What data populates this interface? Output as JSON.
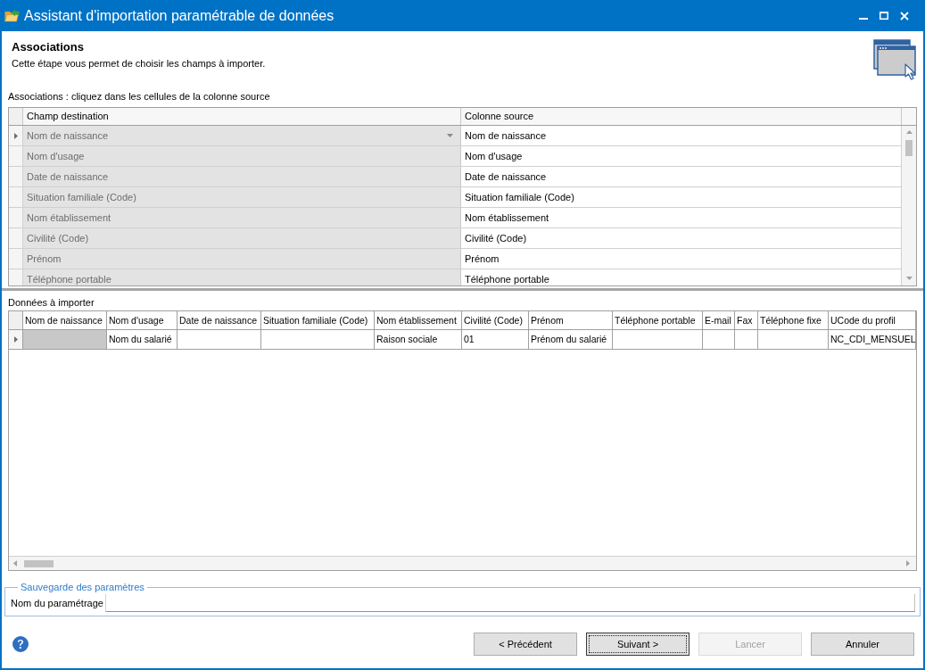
{
  "window": {
    "title": "Assistant d'importation paramétrable de données"
  },
  "header": {
    "title": "Associations",
    "description": "Cette étape vous permet de choisir les champs à importer."
  },
  "associations": {
    "label": "Associations : cliquez dans les cellules de la colonne source",
    "columns": [
      "Champ destination",
      "Colonne source"
    ],
    "rows": [
      {
        "destination": "Nom de naissance",
        "source": "Nom de naissance",
        "selected": true
      },
      {
        "destination": "Nom d'usage",
        "source": "Nom d'usage",
        "selected": false
      },
      {
        "destination": "Date de naissance",
        "source": "Date de naissance",
        "selected": false
      },
      {
        "destination": "Situation familiale (Code)",
        "source": "Situation familiale (Code)",
        "selected": false
      },
      {
        "destination": "Nom établissement",
        "source": "Nom établissement",
        "selected": false
      },
      {
        "destination": "Civilité (Code)",
        "source": "Civilité (Code)",
        "selected": false
      },
      {
        "destination": "Prénom",
        "source": "Prénom",
        "selected": false
      },
      {
        "destination": "Téléphone portable",
        "source": "Téléphone portable",
        "selected": false
      }
    ]
  },
  "import_data": {
    "label": "Données à importer",
    "columns": [
      "Nom de naissance",
      "Nom d'usage",
      "Date de naissance",
      "Situation familiale (Code)",
      "Nom établissement",
      "Civilité (Code)",
      "Prénom",
      "Téléphone portable",
      "E-mail",
      "Fax",
      "Téléphone fixe",
      "UCode du profil"
    ],
    "rows": [
      {
        "selected": true,
        "cells": [
          {
            "focused": true
          },
          {
            "text": "Nom du salarié",
            "focused": false
          },
          {
            "focused": false
          },
          {
            "focused": false
          },
          {
            "text": "Raison sociale",
            "focused": false
          },
          {
            "text": "01",
            "focused": false
          },
          {
            "text": "Prénom du salarié",
            "focused": false
          },
          {
            "focused": false
          },
          {
            "focused": false
          },
          {
            "focused": false
          },
          {
            "focused": false
          },
          {
            "text": "NC_CDI_MENSUEL",
            "focused": false
          }
        ]
      }
    ]
  },
  "save_settings": {
    "legend": "Sauvegarde des paramètres",
    "name_label": "Nom du paramétrage"
  },
  "buttons": [
    {
      "label": "< Précédent",
      "focused": false,
      "disabled": false
    },
    {
      "label": "Suivant >",
      "focused": true,
      "disabled": false
    },
    {
      "label": "Lancer",
      "focused": false,
      "disabled": true
    },
    {
      "label": "Annuler",
      "focused": false,
      "disabled": false
    }
  ]
}
